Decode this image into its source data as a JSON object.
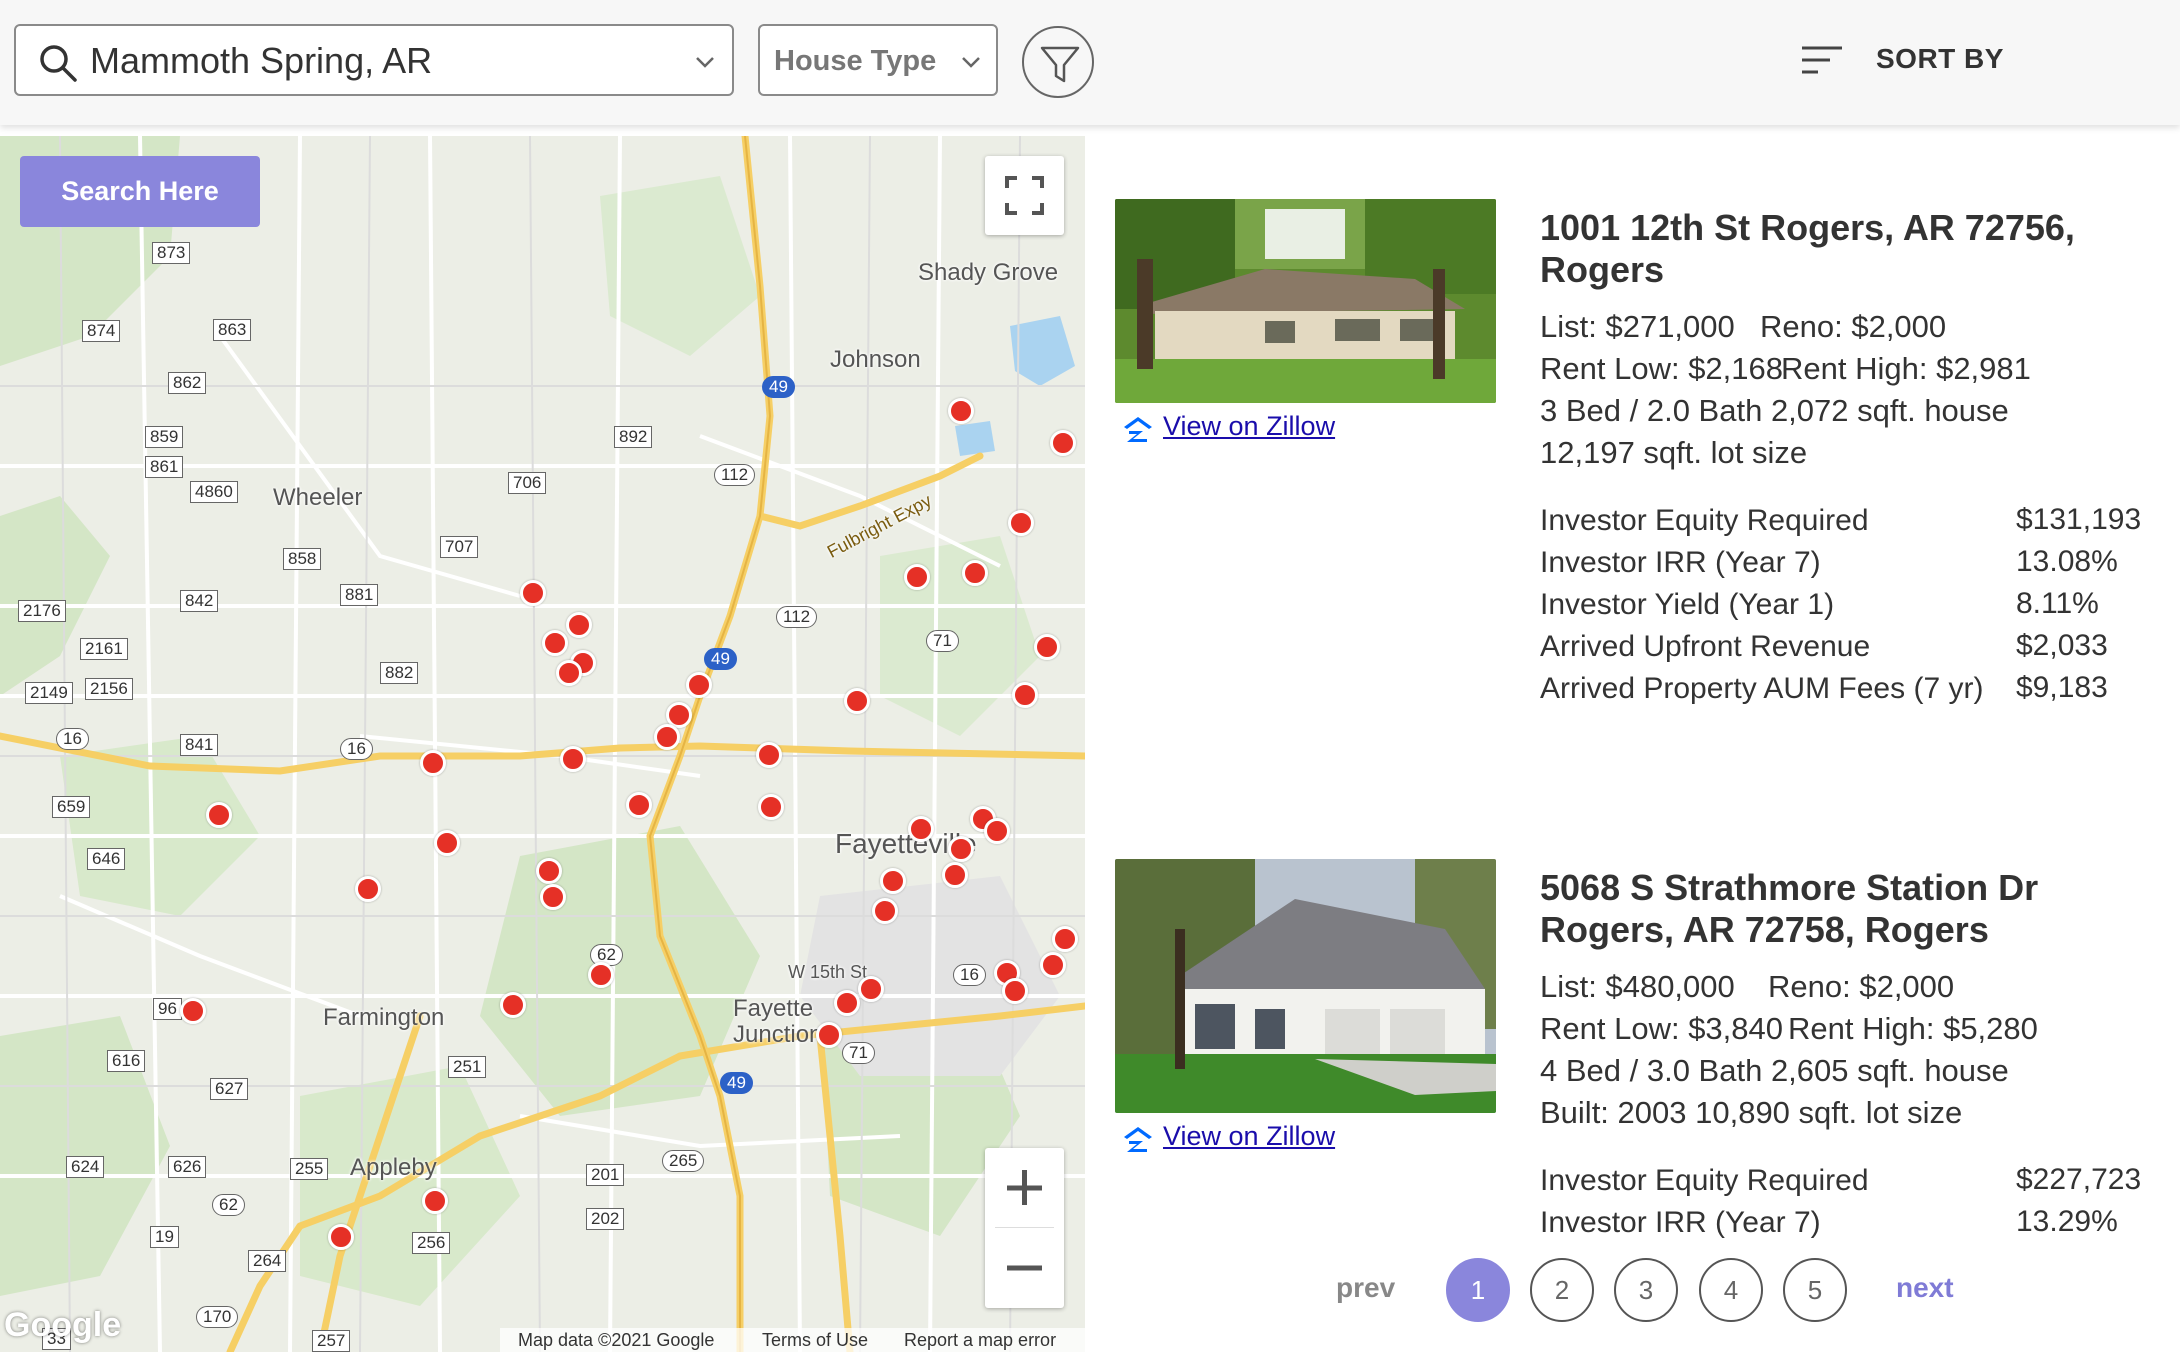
{
  "search": {
    "value": "Mammoth Spring, AR"
  },
  "house_type": {
    "label": "House Type"
  },
  "sort": {
    "label": "SORT BY"
  },
  "map": {
    "search_here_label": "Search Here",
    "footer": {
      "data": "Map data ©2021 Google",
      "terms": "Terms of Use",
      "report": "Report a map error"
    },
    "logo_text": "Google",
    "places": [
      "Shady Grove",
      "Johnson",
      "Wheeler",
      "Fayetteville",
      "Farmington",
      "Fayette Junction",
      "Appleby",
      "Fulbright Expy",
      "W 15th St"
    ],
    "roads": [
      "873",
      "874",
      "863",
      "862",
      "859",
      "861",
      "4860",
      "892",
      "706",
      "707",
      "858",
      "842",
      "881",
      "2176",
      "2161",
      "2149",
      "2156",
      "882",
      "841",
      "659",
      "646",
      "96",
      "616",
      "627",
      "251",
      "624",
      "626",
      "255",
      "201",
      "202",
      "19",
      "264",
      "256",
      "170",
      "257",
      "33"
    ],
    "highways": [
      "112",
      "112",
      "16",
      "16",
      "16",
      "265",
      "62",
      "71",
      "71",
      "62",
      "49",
      "49",
      "49"
    ]
  },
  "listings": [
    {
      "title": "1001 12th St Rogers, AR 72756, Rogers",
      "list": "List: $271,000",
      "reno": "Reno: $2,000",
      "rent_low": "Rent Low: $2,168",
      "rent_high": "Rent High: $2,981",
      "beds_baths": "3 Bed / 2.0 Bath  2,072 sqft. house",
      "lot": "12,197 sqft. lot size",
      "zillow": "View on Zillow",
      "metrics": [
        {
          "label": "Investor Equity Required",
          "value": "$131,193"
        },
        {
          "label": "Investor IRR (Year 7)",
          "value": "13.08%"
        },
        {
          "label": "Investor Yield (Year 1)",
          "value": "8.11%"
        },
        {
          "label": "Arrived Upfront Revenue",
          "value": "$2,033"
        },
        {
          "label": "Arrived Property AUM Fees (7 yr)",
          "value": "$9,183"
        }
      ]
    },
    {
      "title": "5068 S Strathmore Station Dr Rogers, AR 72758, Rogers",
      "list": "List: $480,000",
      "reno": "Reno: $2,000",
      "rent_low": "Rent Low: $3,840",
      "rent_high": "Rent High: $5,280",
      "beds_baths": "4 Bed / 3.0 Bath  2,605 sqft. house",
      "lot": "Built: 2003  10,890 sqft. lot size",
      "zillow": "View on Zillow",
      "metrics": [
        {
          "label": "Investor Equity Required",
          "value": "$227,723"
        },
        {
          "label": "Investor IRR (Year 7)",
          "value": "13.29%"
        }
      ]
    }
  ],
  "pagination": {
    "prev": "prev",
    "next": "next",
    "pages": [
      "1",
      "2",
      "3",
      "4",
      "5"
    ],
    "current": "1"
  },
  "colors": {
    "accent": "#8a86dc",
    "pin": "#e53026",
    "link": "#1a0dab"
  }
}
